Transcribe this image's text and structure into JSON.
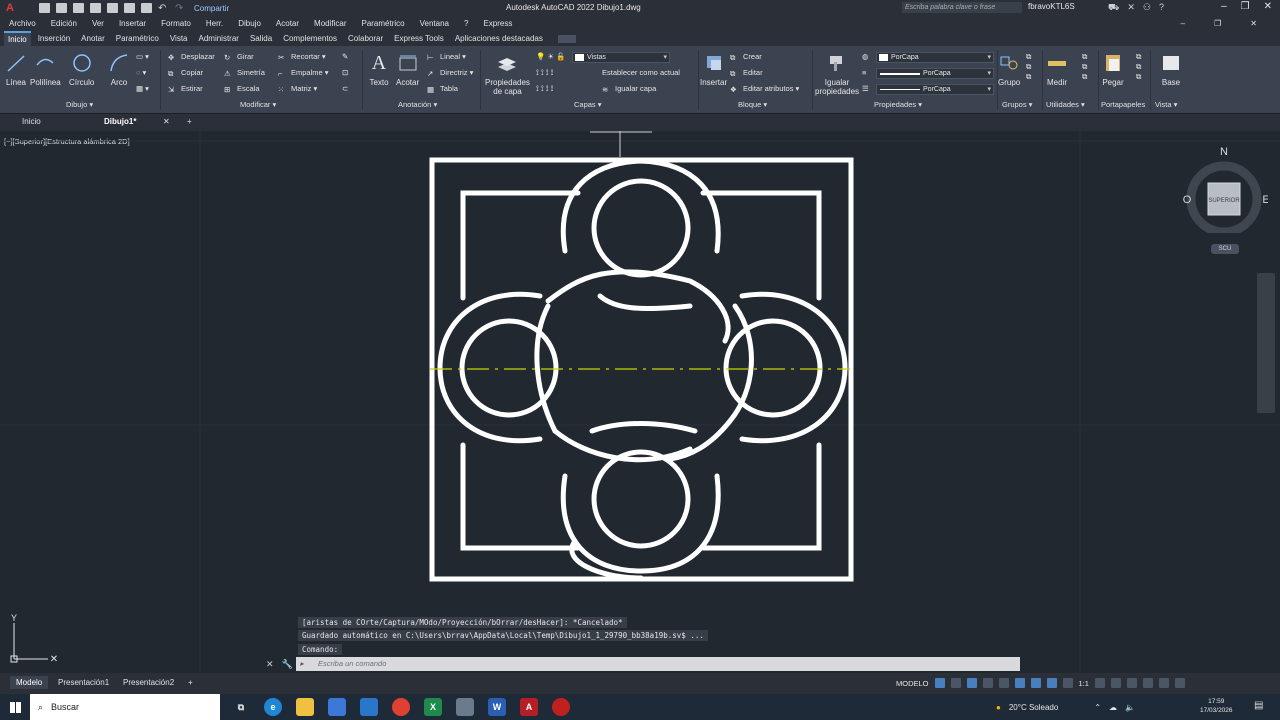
{
  "titlebar": {
    "logo": "A",
    "share": "Compartir",
    "title": "Autodesk AutoCAD 2022   Dibujo1.dwg",
    "search_placeholder": "Escriba palabra clave o frase",
    "user": "fbravoKTL6S",
    "win_min": "–",
    "win_restore": "❐",
    "win_close": "✕"
  },
  "menubar": [
    "Archivo",
    "Edición",
    "Ver",
    "Insertar",
    "Formato",
    "Herr.",
    "Dibujo",
    "Acotar",
    "Modificar",
    "Paramétrico",
    "Ventana",
    "?",
    "Express"
  ],
  "ribbon_tabs": [
    "Inicio",
    "Inserción",
    "Anotar",
    "Paramétrico",
    "Vista",
    "Administrar",
    "Salida",
    "Complementos",
    "Colaborar",
    "Express Tools",
    "Aplicaciones destacadas"
  ],
  "ribbon": {
    "dibujo": {
      "linea": "Línea",
      "polilinea": "Polilínea",
      "circulo": "Círculo",
      "arco": "Arco",
      "title": "Dibujo ▾"
    },
    "modificar": {
      "desplazar": "Desplazar",
      "girar": "Girar",
      "recortar": "Recortar",
      "copiar": "Copiar",
      "simetria": "Simetría",
      "empalme": "Empalme",
      "estirar": "Estirar",
      "escala": "Escala",
      "matriz": "Matriz",
      "title": "Modificar ▾"
    },
    "anotacion": {
      "texto": "Texto",
      "acotar": "Acotar",
      "lineal": "Lineal",
      "directriz": "Directriz",
      "tabla": "Tabla",
      "title": "Anotación ▾"
    },
    "capas": {
      "propiedades": "Propiedades",
      "de_capa": "de capa",
      "vistas": "Vistas",
      "establecer": "Establecer como actual",
      "igualar": "Igualar capa",
      "title": "Capas ▾"
    },
    "bloque": {
      "insertar": "Insertar",
      "crear": "Crear",
      "editar": "Editar",
      "editar_atributos": "Editar atributos",
      "title": "Bloque ▾"
    },
    "propiedades": {
      "igualar": "Igualar",
      "propiedades": "propiedades",
      "color": "PorCapa",
      "lineweight": "PorCapa",
      "linetype": "PorCapa",
      "title": "Propiedades ▾"
    },
    "grupos": {
      "grupo": "Grupo",
      "title": "Grupos ▾"
    },
    "utilidades": {
      "medir": "Medir",
      "title": "Utilidades ▾"
    },
    "portapapeles": {
      "pegar": "Pegar",
      "title": "Portapapeles"
    },
    "vista": {
      "base": "Base",
      "title": "Vista ▾"
    }
  },
  "file_tabs": {
    "inicio": "Inicio",
    "dibujo1": "Dibujo1*",
    "close": "✕",
    "add": "+"
  },
  "viewport": {
    "label": "[−][Superior][Estructura alámbrica 2D]",
    "viewcube": {
      "n": "N",
      "s": "S",
      "e": "E",
      "o": "O",
      "face": "SUPERIOR",
      "scu": "SCU"
    },
    "ucs": {
      "y": "Y"
    }
  },
  "command": {
    "history": [
      "[aristas de COrte/Captura/MOdo/Proyección/bOrrar/desHacer]: *Cancelado*",
      "Guardado automático en C:\\Users\\brrav\\AppData\\Local\\Temp\\Dibujo1_1_29790_bb38a19b.sv$ ...",
      "Comando:"
    ],
    "placeholder": "Escriba un comando"
  },
  "layout_tabs": [
    "Modelo",
    "Presentación1",
    "Presentación2"
  ],
  "status": {
    "modelo": "MODELO",
    "scale": "1:1"
  },
  "taskbar": {
    "search": "Buscar",
    "weather": "20°C  Soleado",
    "time": "17:59",
    "date": "17/03/2026"
  },
  "colors": {
    "accent": "#5aa0e6",
    "centerline": "#c8d400",
    "drawing": "#ffffff",
    "background": "#212830"
  }
}
